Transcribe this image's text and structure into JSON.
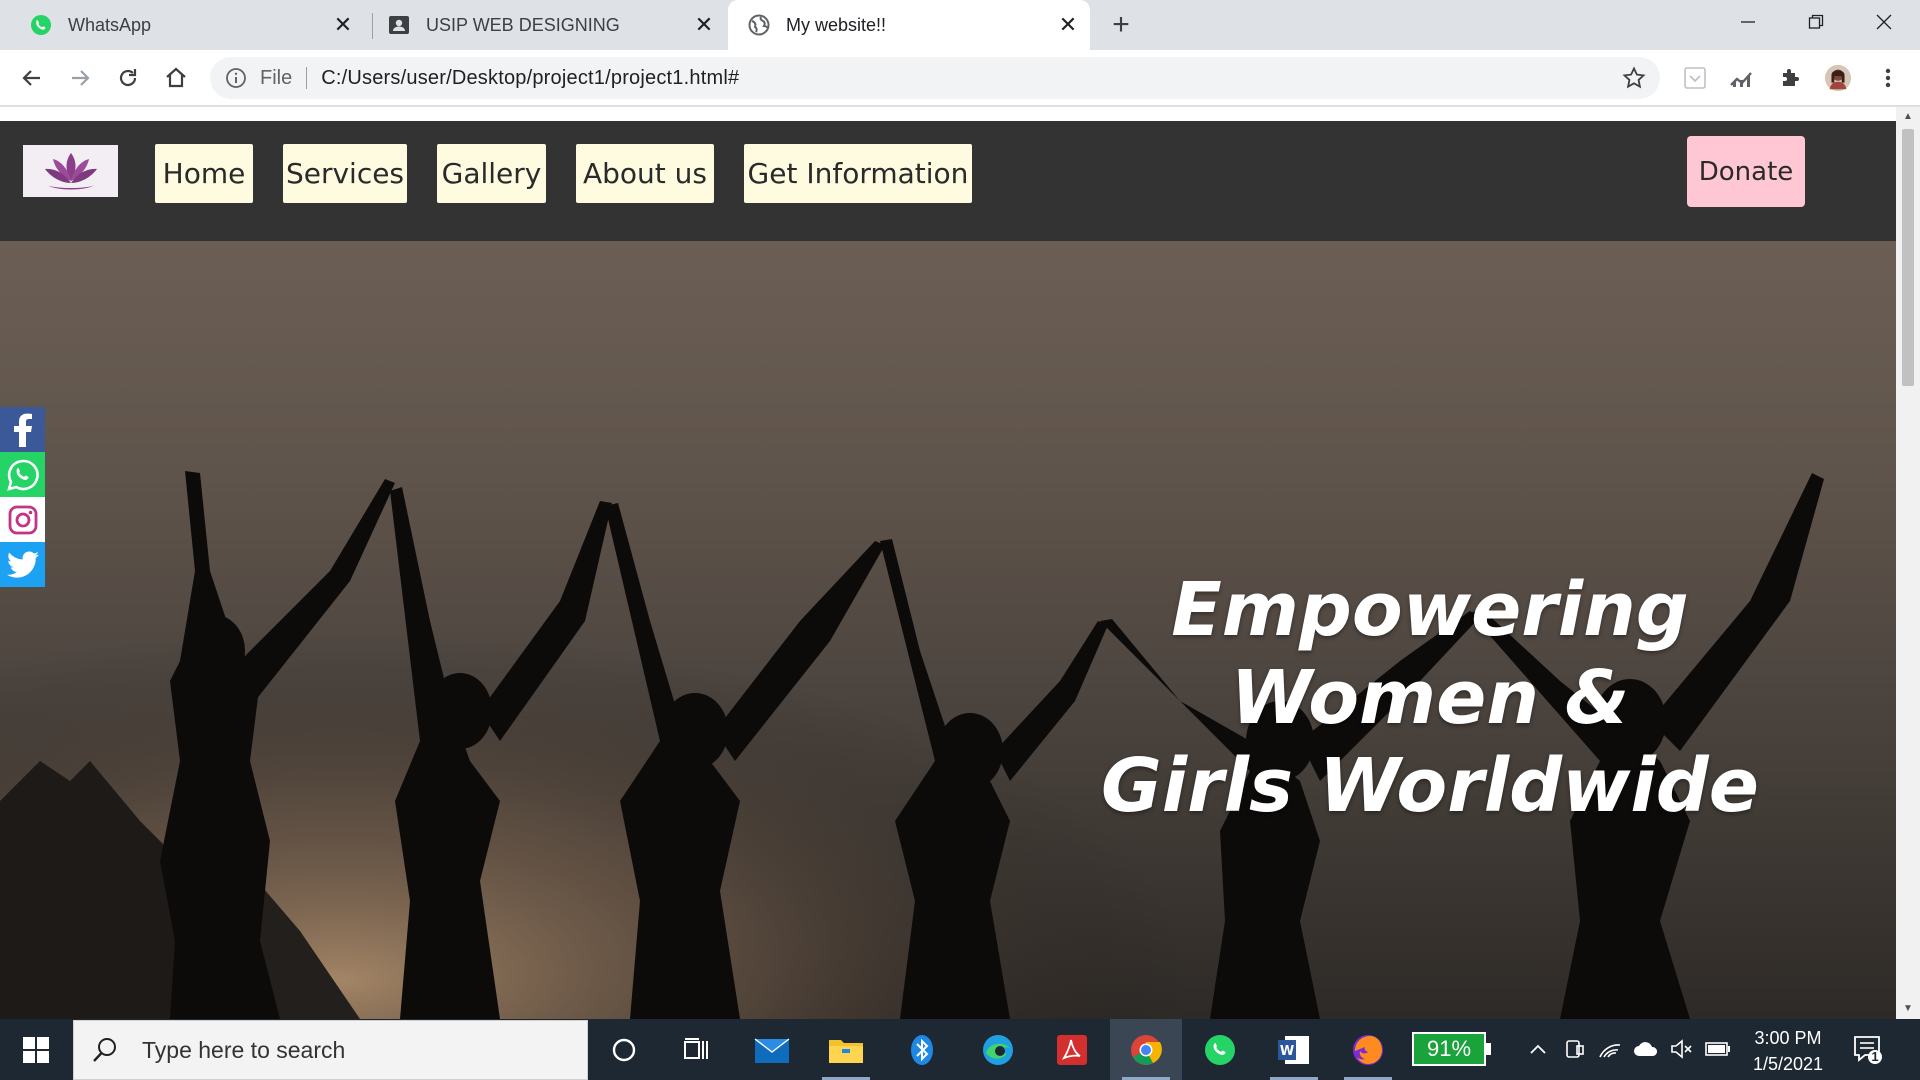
{
  "browser": {
    "tabs": [
      {
        "title": "WhatsApp",
        "icon": "whatsapp-icon",
        "active": false
      },
      {
        "title": "USIP WEB DESIGNING",
        "icon": "classroom-icon",
        "active": false
      },
      {
        "title": "My website!!",
        "icon": "globe-icon",
        "active": true
      }
    ],
    "close_glyph": "✕",
    "new_tab_glyph": "+",
    "omnibox": {
      "scheme": "File",
      "url": "C:/Users/user/Desktop/project1/project1.html#"
    }
  },
  "site": {
    "nav": {
      "links": [
        "Home",
        "Services",
        "Gallery",
        "About us",
        "Get Information"
      ],
      "donate_label": "Donate"
    },
    "hero": {
      "headline_line1": "Empowering Women &",
      "headline_line2": "Girls Worldwide"
    },
    "social": [
      {
        "name": "facebook-icon",
        "color": "#3b5998"
      },
      {
        "name": "whatsapp-icon",
        "color": "#25d366"
      },
      {
        "name": "instagram-icon",
        "color": "#ffffff"
      },
      {
        "name": "twitter-icon",
        "color": "#1da1f2"
      }
    ]
  },
  "taskbar": {
    "search_placeholder": "Type here to search",
    "battery_label": "91%",
    "time": "3:00 PM",
    "date": "1/5/2021",
    "notification_count": "1"
  },
  "colors": {
    "nav_background": "#333333",
    "nav_link_background": "#fffbe0",
    "donate_background": "#ffc6d4",
    "battery_green": "#1aa33b",
    "taskbar_background": "#1e2833"
  }
}
